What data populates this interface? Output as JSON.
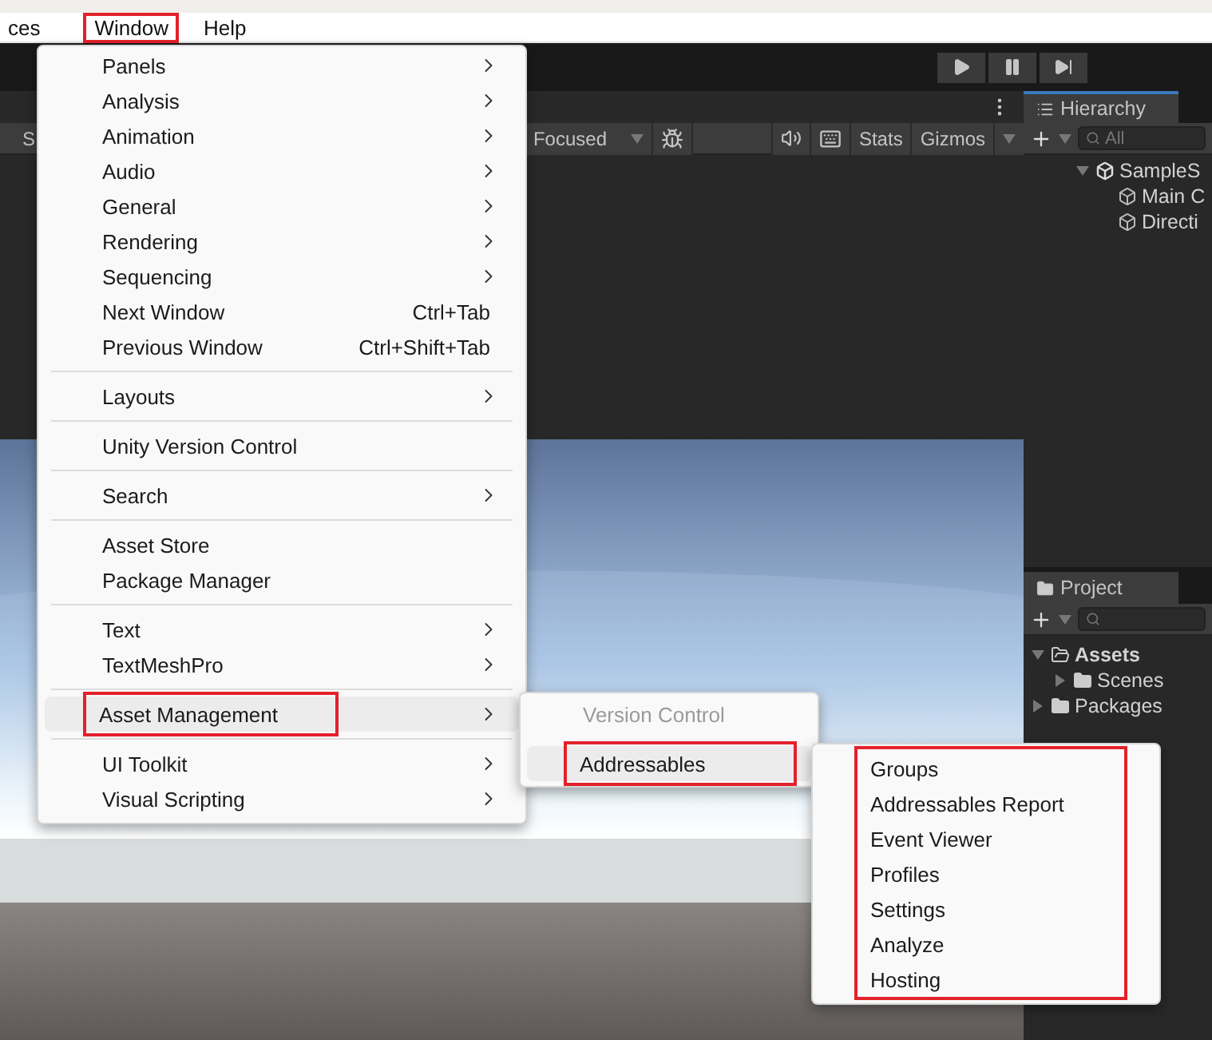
{
  "menubar": [
    {
      "label": "ces",
      "annotated": false
    },
    {
      "label": "Window",
      "annotated": true
    },
    {
      "label": "Help",
      "annotated": false
    }
  ],
  "scene_toolbar": {
    "tab": "S",
    "focus_dropdown": "Focused",
    "buttons": [
      {
        "kind": "bug"
      },
      {
        "kind": "audio"
      },
      {
        "kind": "keyboard"
      },
      {
        "kind": "text",
        "label": "Stats"
      },
      {
        "kind": "text",
        "label": "Gizmos"
      },
      {
        "kind": "caret"
      }
    ]
  },
  "hierarchy": {
    "title": "Hierarchy",
    "search": {
      "placeholder": "All"
    },
    "tree": [
      {
        "label": "SampleS",
        "kind": "scene",
        "expanded": true,
        "children": [
          {
            "label": "Main C",
            "kind": "object"
          },
          {
            "label": "Directi",
            "kind": "object"
          }
        ]
      }
    ]
  },
  "project": {
    "title": "Project",
    "tree": [
      {
        "label": "Assets",
        "kind": "folder",
        "expanded": true,
        "children": [
          {
            "label": "Scenes",
            "kind": "folder",
            "expanded": false
          }
        ]
      },
      {
        "label": "Packages",
        "kind": "folder",
        "expanded": false
      }
    ]
  },
  "window_menu": {
    "groups": [
      [
        {
          "label": "Panels",
          "submenu": true
        },
        {
          "label": "Analysis",
          "submenu": true
        },
        {
          "label": "Animation",
          "submenu": true
        },
        {
          "label": "Audio",
          "submenu": true
        },
        {
          "label": "General",
          "submenu": true
        },
        {
          "label": "Rendering",
          "submenu": true
        },
        {
          "label": "Sequencing",
          "submenu": true
        },
        {
          "label": "Next Window",
          "shortcut": "Ctrl+Tab",
          "submenu": false
        },
        {
          "label": "Previous Window",
          "shortcut": "Ctrl+Shift+Tab",
          "submenu": false
        }
      ],
      [
        {
          "label": "Layouts",
          "submenu": true
        }
      ],
      [
        {
          "label": "Unity Version Control",
          "submenu": false
        }
      ],
      [
        {
          "label": "Search",
          "submenu": true
        }
      ],
      [
        {
          "label": "Asset Store",
          "submenu": false
        },
        {
          "label": "Package Manager",
          "submenu": false
        }
      ],
      [
        {
          "label": "Text",
          "submenu": true
        },
        {
          "label": "TextMeshPro",
          "submenu": true
        }
      ],
      [
        {
          "label": "Asset Management",
          "submenu": true,
          "selected": true,
          "annotated": true
        }
      ],
      [
        {
          "label": "UI Toolkit",
          "submenu": true
        },
        {
          "label": "Visual Scripting",
          "submenu": true
        }
      ]
    ]
  },
  "asset_management_menu": [
    {
      "label": "Version Control",
      "disabled": true,
      "submenu": false,
      "selected": false,
      "annotated": false
    },
    {
      "label": "Addressables",
      "disabled": false,
      "submenu": true,
      "selected": true,
      "annotated": true
    }
  ],
  "addressables_menu": {
    "annotated": true,
    "items": [
      "Groups",
      "Addressables Report",
      "Event Viewer",
      "Profiles",
      "Settings",
      "Analyze",
      "Hosting"
    ]
  }
}
